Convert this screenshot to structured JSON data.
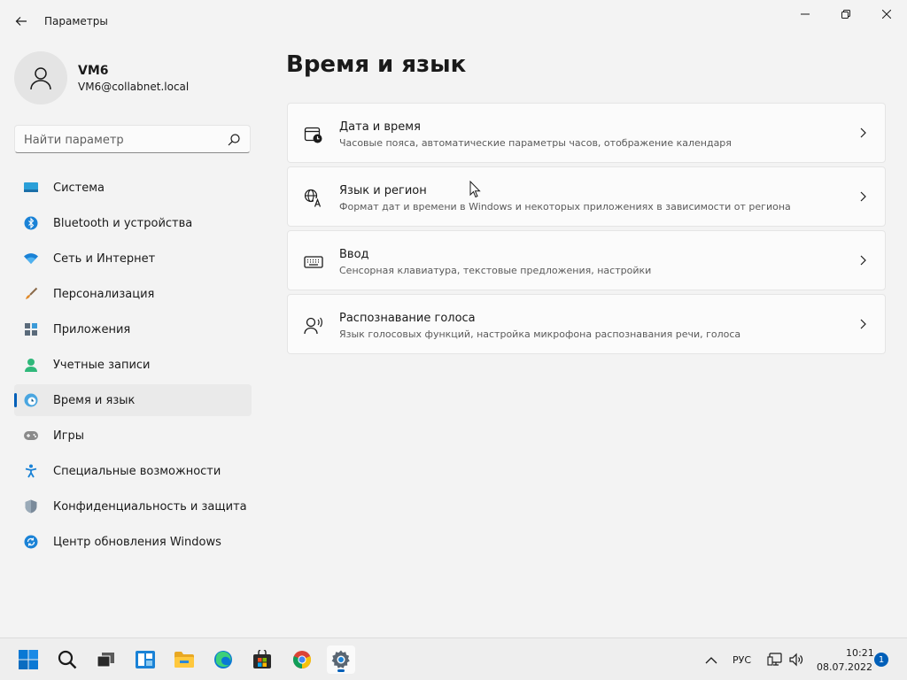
{
  "window": {
    "title": "Параметры"
  },
  "profile": {
    "name": "VM6",
    "email": "VM6@collabnet.local"
  },
  "search": {
    "placeholder": "Найти параметр"
  },
  "sidebar": {
    "items": [
      {
        "label": "Система",
        "icon": "system-icon",
        "active": false
      },
      {
        "label": "Bluetooth и устройства",
        "icon": "bluetooth-icon",
        "active": false
      },
      {
        "label": "Сеть и Интернет",
        "icon": "wifi-icon",
        "active": false
      },
      {
        "label": "Персонализация",
        "icon": "brush-icon",
        "active": false
      },
      {
        "label": "Приложения",
        "icon": "apps-icon",
        "active": false
      },
      {
        "label": "Учетные записи",
        "icon": "person-icon",
        "active": false
      },
      {
        "label": "Время и язык",
        "icon": "globe-clock-icon",
        "active": true
      },
      {
        "label": "Игры",
        "icon": "gamepad-icon",
        "active": false
      },
      {
        "label": "Специальные возможности",
        "icon": "accessibility-icon",
        "active": false
      },
      {
        "label": "Конфиденциальность и защита",
        "icon": "shield-icon",
        "active": false
      },
      {
        "label": "Центр обновления Windows",
        "icon": "update-icon",
        "active": false
      }
    ]
  },
  "main": {
    "title": "Время и язык",
    "cards": [
      {
        "title": "Дата и время",
        "desc": "Часовые пояса, автоматические параметры часов, отображение календаря",
        "icon": "calendar-clock-icon"
      },
      {
        "title": "Язык и регион",
        "desc": "Формат дат и времени в Windows и некоторых приложениях в зависимости от региона",
        "icon": "language-icon"
      },
      {
        "title": "Ввод",
        "desc": "Сенсорная клавиатура, текстовые предложения, настройки",
        "icon": "keyboard-icon"
      },
      {
        "title": "Распознавание голоса",
        "desc": "Язык голосовых функций, настройка микрофона распознавания речи, голоса",
        "icon": "speech-icon"
      }
    ]
  },
  "taskbar": {
    "apps": [
      "start-icon",
      "search-icon",
      "task-view-icon",
      "widgets-icon",
      "file-explorer-icon",
      "edge-icon",
      "store-icon",
      "chrome-icon",
      "settings-icon"
    ],
    "tray": {
      "language": "РУС",
      "time": "10:21",
      "date": "08.07.2022",
      "notifications": "1"
    }
  },
  "colors": {
    "accent": "#005fb8",
    "background": "#f3f3f3",
    "card": "#fbfbfb"
  }
}
